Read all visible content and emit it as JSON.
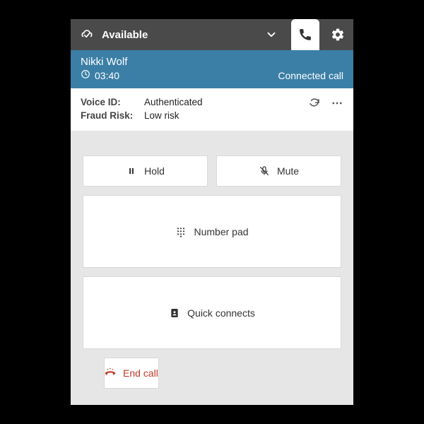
{
  "topbar": {
    "status_label": "Available"
  },
  "call": {
    "caller_name": "Nikki Wolf",
    "timer": "03:40",
    "status": "Connected call"
  },
  "voice": {
    "voice_id_label": "Voice ID:",
    "voice_id_value": "Authenticated",
    "fraud_label": "Fraud Risk:",
    "fraud_value": "Low risk"
  },
  "controls": {
    "hold": "Hold",
    "mute": "Mute",
    "number_pad": "Number pad",
    "quick_connects": "Quick connects",
    "end_call": "End call"
  }
}
